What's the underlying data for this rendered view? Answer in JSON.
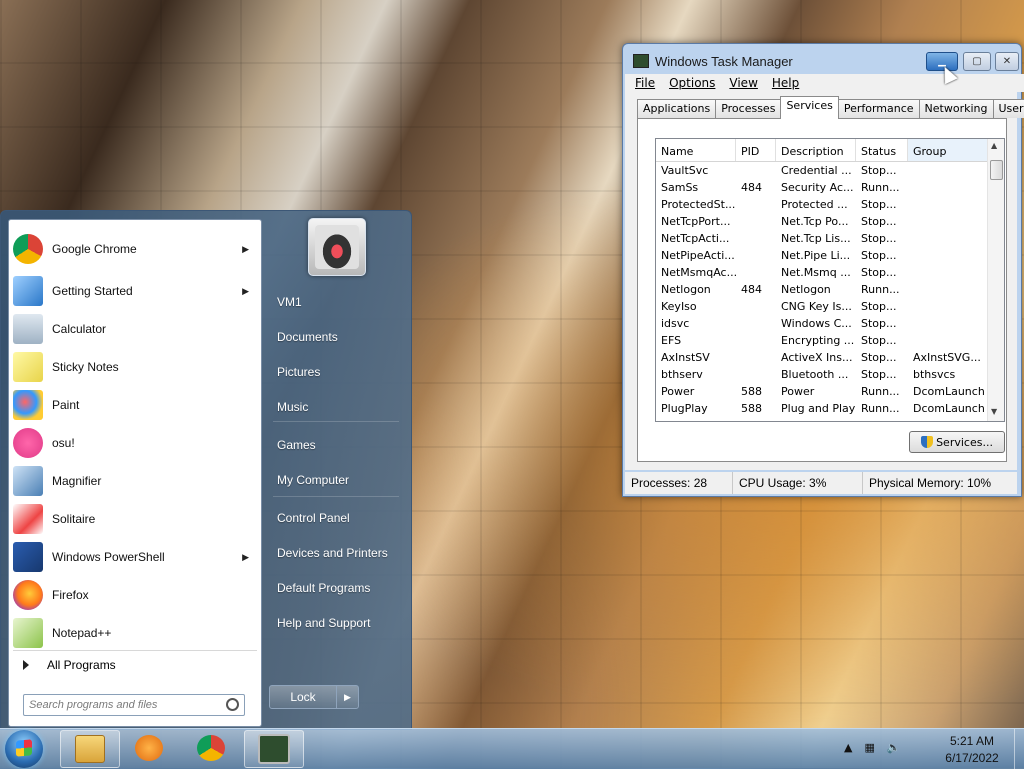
{
  "taskmgr": {
    "title": "Windows Task Manager",
    "menu": [
      "File",
      "Options",
      "View",
      "Help"
    ],
    "tabs": [
      "Applications",
      "Processes",
      "Services",
      "Performance",
      "Networking",
      "Users"
    ],
    "active_tab": "Services",
    "columns": [
      "Name",
      "PID",
      "Description",
      "Status",
      "Group"
    ],
    "rows": [
      [
        "VaultSvc",
        "",
        "Credential ...",
        "Stop...",
        ""
      ],
      [
        "SamSs",
        "484",
        "Security Ac...",
        "Runn...",
        ""
      ],
      [
        "ProtectedSt...",
        "",
        "Protected ...",
        "Stop...",
        ""
      ],
      [
        "NetTcpPort...",
        "",
        "Net.Tcp Po...",
        "Stop...",
        ""
      ],
      [
        "NetTcpActi...",
        "",
        "Net.Tcp Lis...",
        "Stop...",
        ""
      ],
      [
        "NetPipeActi...",
        "",
        "Net.Pipe Li...",
        "Stop...",
        ""
      ],
      [
        "NetMsmqAc...",
        "",
        "Net.Msmq ...",
        "Stop...",
        ""
      ],
      [
        "Netlogon",
        "484",
        "Netlogon",
        "Runn...",
        ""
      ],
      [
        "KeyIso",
        "",
        "CNG Key Is...",
        "Stop...",
        ""
      ],
      [
        "idsvc",
        "",
        "Windows C...",
        "Stop...",
        ""
      ],
      [
        "EFS",
        "",
        "Encrypting ...",
        "Stop...",
        ""
      ],
      [
        "AxInstSV",
        "",
        "ActiveX Ins...",
        "Stop...",
        "AxInstSVG..."
      ],
      [
        "bthserv",
        "",
        "Bluetooth ...",
        "Stop...",
        "bthsvcs"
      ],
      [
        "Power",
        "588",
        "Power",
        "Runn...",
        "DcomLaunch"
      ],
      [
        "PlugPlay",
        "588",
        "Plug and Play",
        "Runn...",
        "DcomLaunch"
      ]
    ],
    "services_button": "Services...",
    "status": {
      "processes": "Processes: 28",
      "cpu": "CPU Usage: 3%",
      "memory": "Physical Memory: 10%"
    }
  },
  "start_menu": {
    "programs": [
      {
        "label": "Google Chrome",
        "icon": "chrome-icon",
        "submenu": true
      },
      {
        "label": "Getting Started",
        "icon": "getting-started-icon",
        "submenu": true
      },
      {
        "label": "Calculator",
        "icon": "calculator-icon",
        "submenu": false
      },
      {
        "label": "Sticky Notes",
        "icon": "sticky-notes-icon",
        "submenu": false
      },
      {
        "label": "Paint",
        "icon": "paint-icon",
        "submenu": false
      },
      {
        "label": "osu!",
        "icon": "osu-icon",
        "submenu": false
      },
      {
        "label": "Magnifier",
        "icon": "magnifier-icon",
        "submenu": false
      },
      {
        "label": "Solitaire",
        "icon": "solitaire-icon",
        "submenu": false
      },
      {
        "label": "Windows PowerShell",
        "icon": "powershell-icon",
        "submenu": true
      },
      {
        "label": "Firefox",
        "icon": "firefox-icon",
        "submenu": false
      },
      {
        "label": "Notepad++",
        "icon": "notepadpp-icon",
        "submenu": false
      }
    ],
    "all_programs": "All Programs",
    "search_placeholder": "Search programs and files",
    "right_items": [
      "VM1",
      "Documents",
      "Pictures",
      "Music",
      "Games",
      "My Computer",
      "Control Panel",
      "Devices and Printers",
      "Default Programs",
      "Help and Support"
    ],
    "lock_label": "Lock"
  },
  "taskbar": {
    "time": "5:21 AM",
    "date": "6/17/2022"
  }
}
